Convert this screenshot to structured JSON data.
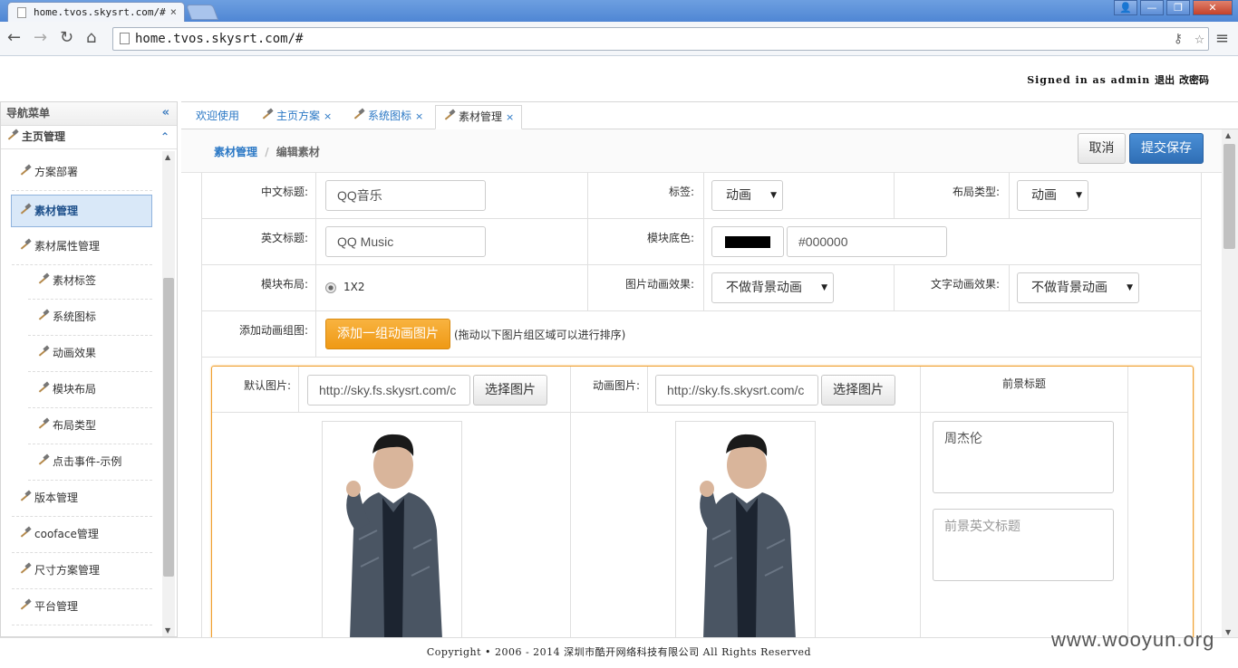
{
  "browser": {
    "tab_title": "home.tvos.skysrt.com/#",
    "tab_close": "×",
    "url": "home.tvos.skysrt.com/#",
    "win_buttons": [
      "👤",
      "—",
      "❐",
      "✕"
    ]
  },
  "header": {
    "signed_in": "Signed in as admin",
    "logout": "退出",
    "change_password": "改密码"
  },
  "sidebar": {
    "title": "导航菜单",
    "collapse": "«",
    "group": "主页管理",
    "group_toggle": "⌃",
    "items": [
      {
        "label": "方案部署"
      },
      {
        "label": "素材管理"
      },
      {
        "label": "素材属性管理"
      },
      {
        "label": "素材标签"
      },
      {
        "label": "系统图标"
      },
      {
        "label": "动画效果"
      },
      {
        "label": "模块布局"
      },
      {
        "label": "布局类型"
      },
      {
        "label": "点击事件-示例"
      },
      {
        "label": "版本管理"
      },
      {
        "label": "cooface管理"
      },
      {
        "label": "尺寸方案管理"
      },
      {
        "label": "平台管理"
      }
    ]
  },
  "tabs": [
    {
      "label": "欢迎使用"
    },
    {
      "label": "主页方案",
      "close": "×"
    },
    {
      "label": "系统图标",
      "close": "×"
    },
    {
      "label": "素材管理",
      "close": "×"
    }
  ],
  "breadcrumb": {
    "root": "素材管理",
    "sep": "/",
    "current": "编辑素材"
  },
  "actions": {
    "cancel": "取消",
    "save": "提交保存"
  },
  "form": {
    "cn_title_label": "中文标题:",
    "cn_title_value": "QQ音乐",
    "tag_label": "标签:",
    "tag_value": "动画",
    "layout_type_label": "布局类型:",
    "layout_type_value": "动画",
    "en_title_label": "英文标题:",
    "en_title_value": "QQ Music",
    "bg_color_label": "模块底色:",
    "bg_color_value": "#000000",
    "block_layout_label": "模块布局:",
    "block_layout_value": "1X2",
    "img_anim_label": "图片动画效果:",
    "img_anim_value": "不做背景动画",
    "text_anim_label": "文字动画效果:",
    "text_anim_value": "不做背景动画",
    "add_group_label": "添加动画组图:",
    "add_group_button": "添加一组动画图片",
    "add_group_hint": "(拖动以下图片组区域可以进行排序)"
  },
  "image_group": {
    "default_label": "默认图片:",
    "default_url": "http://sky.fs.skysrt.com/c",
    "anim_label": "动画图片:",
    "anim_url": "http://sky.fs.skysrt.com/c",
    "pick_button": "选择图片",
    "fg_title_header": "前景标题",
    "fg_title_value": "周杰伦",
    "fg_en_placeholder": "前景英文标题"
  },
  "footer": "Copyright • 2006 - 2014 深圳市酷开网络科技有限公司 All Rights Reserved",
  "watermark": "www.wooyun.org"
}
